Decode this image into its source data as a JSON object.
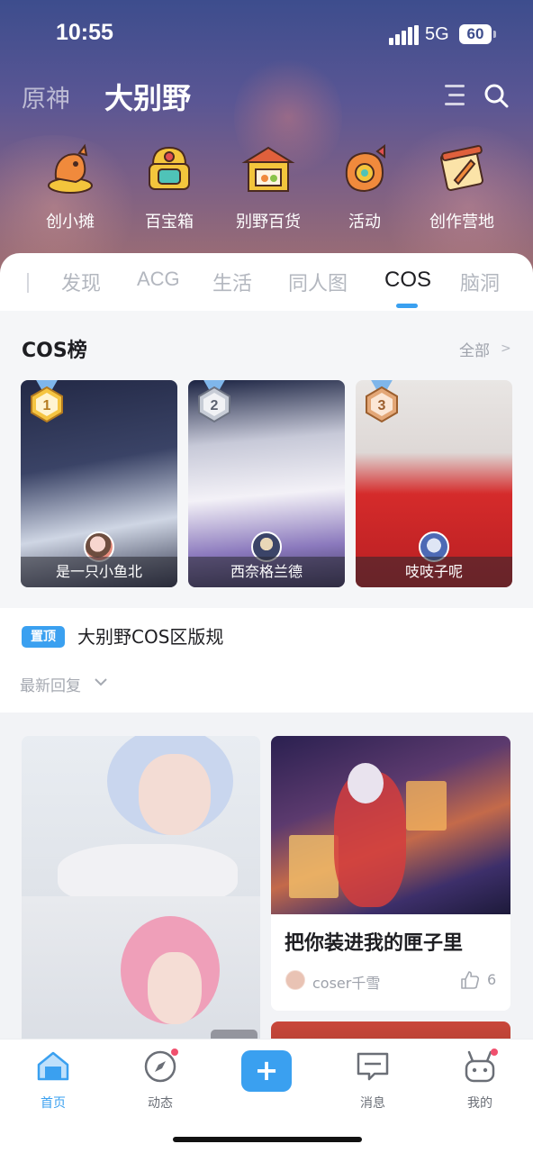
{
  "status_bar": {
    "time": "10:55",
    "network": "5G",
    "battery": "60"
  },
  "top_nav": {
    "game": "原神",
    "section": "大别野"
  },
  "shortcuts": [
    {
      "label": "创小摊",
      "icon": "stall-icon"
    },
    {
      "label": "百宝箱",
      "icon": "treasure-box-icon"
    },
    {
      "label": "别野百货",
      "icon": "shop-icon"
    },
    {
      "label": "活动",
      "icon": "event-icon"
    },
    {
      "label": "创作营地",
      "icon": "creator-camp-icon"
    }
  ],
  "tabs": [
    "发现",
    "ACG",
    "生活",
    "同人图",
    "COS",
    "脑洞"
  ],
  "active_tab": "COS",
  "rank": {
    "title": "COS榜",
    "all_label": "全部",
    "entries": [
      {
        "rank": "1",
        "name": "是一只小鱼北"
      },
      {
        "rank": "2",
        "name": "西奈格兰德"
      },
      {
        "rank": "3",
        "name": "吱吱子呢"
      }
    ]
  },
  "notice": {
    "badge": "置顶",
    "title": "大别野COS区版规",
    "sort_label": "最新回复"
  },
  "posts": [
    {
      "title": "把你装进我的匣子里",
      "author": "coser千雪",
      "likes": "6"
    }
  ],
  "tabbar": [
    {
      "label": "首页",
      "active": true
    },
    {
      "label": "动态",
      "active": false
    },
    {
      "label": "",
      "active": false
    },
    {
      "label": "消息",
      "active": false
    },
    {
      "label": "我的",
      "active": false
    }
  ],
  "colors": {
    "accent": "#3aa0f0",
    "badge_red": "#f0506e"
  }
}
